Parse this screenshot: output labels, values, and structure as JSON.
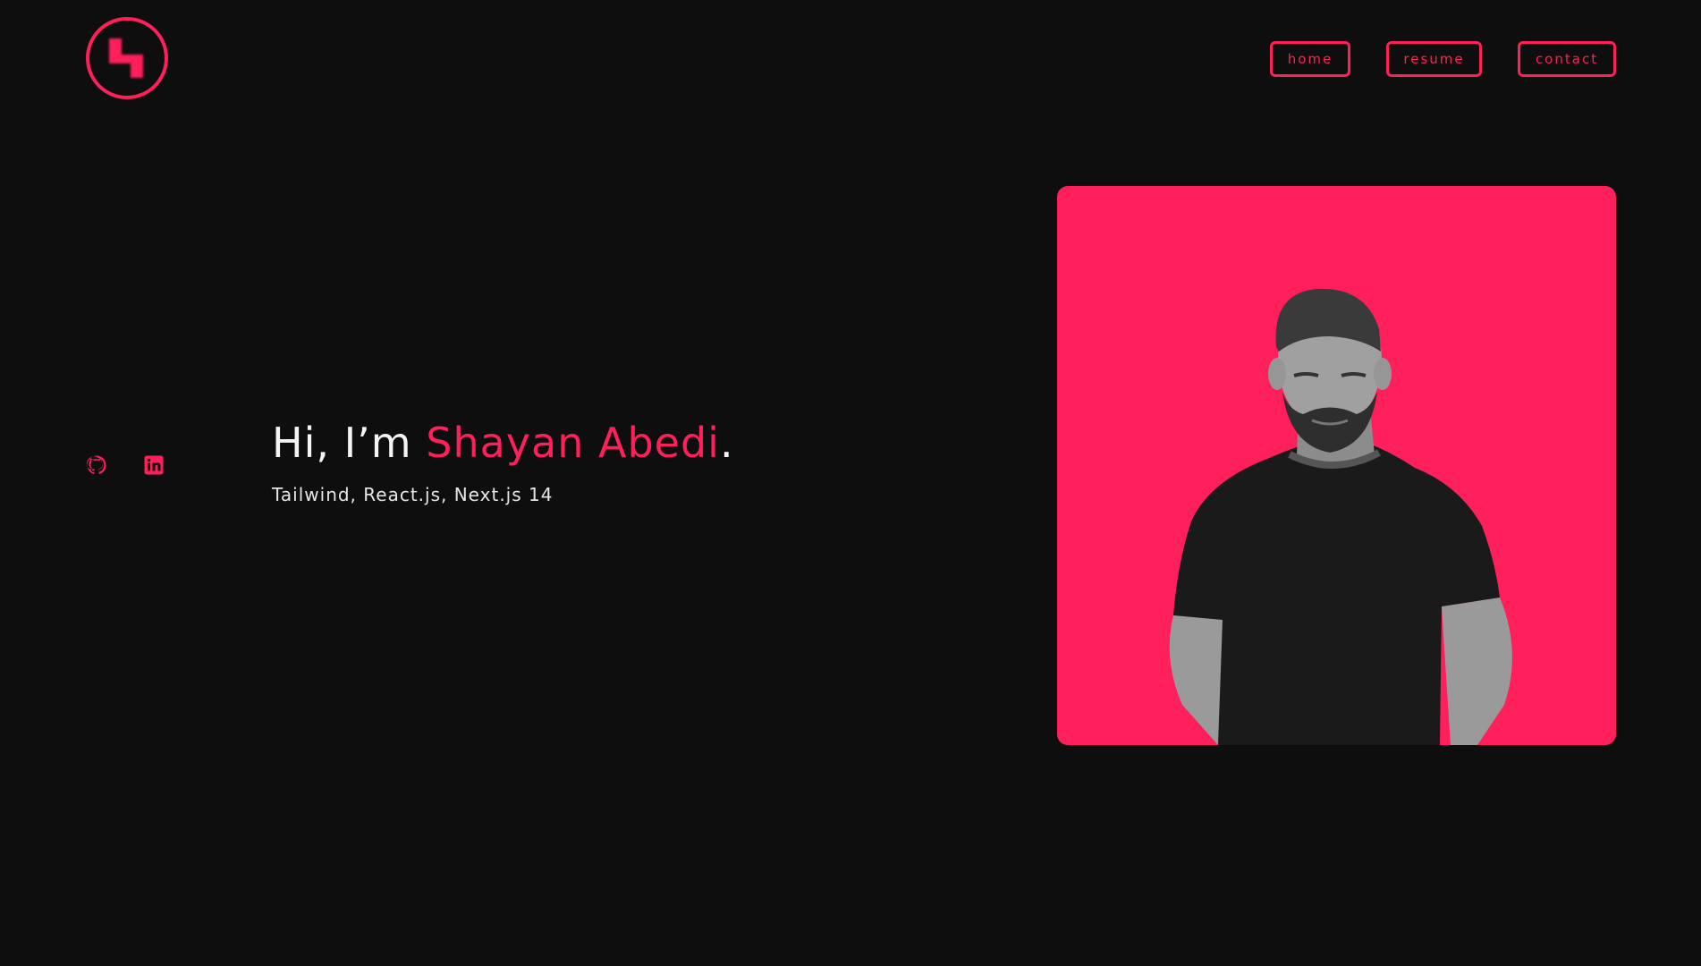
{
  "header": {
    "logo_icon": "brand-logo-icon",
    "nav": [
      {
        "label": "home"
      },
      {
        "label": "resume"
      },
      {
        "label": "contact"
      }
    ]
  },
  "hero": {
    "greeting": "Hi, I’m",
    "name": "Shayan Abedi",
    "period": ".",
    "subtitle": "Tailwind, React.js, Next.js 14"
  },
  "social": [
    {
      "icon": "github-icon"
    },
    {
      "icon": "linkedin-icon"
    }
  ],
  "portrait": {
    "icon": "avatar-illustration"
  },
  "colors": {
    "accent": "#ff1f5a",
    "background": "#0e0e0f",
    "text": "#f2f2f2"
  }
}
